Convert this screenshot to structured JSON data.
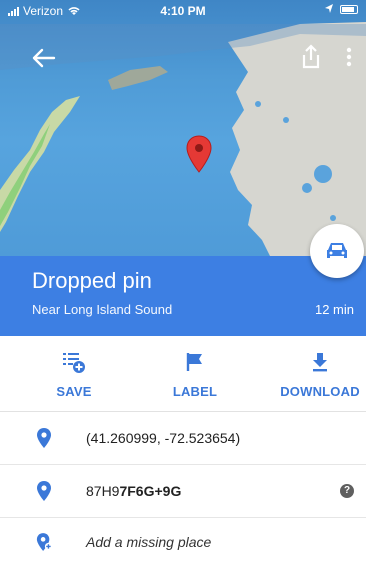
{
  "status_bar": {
    "carrier": "Verizon",
    "time": "4:10 PM"
  },
  "top_bar": {
    "back_icon": "back-arrow-icon",
    "share_icon": "share-icon",
    "more_icon": "more-vert-icon"
  },
  "place": {
    "title": "Dropped pin",
    "subtitle": "Near Long Island Sound",
    "eta": "12 min"
  },
  "actions": [
    {
      "label": "SAVE",
      "icon": "save-list-icon"
    },
    {
      "label": "LABEL",
      "icon": "flag-icon"
    },
    {
      "label": "DOWNLOAD",
      "icon": "download-icon"
    }
  ],
  "info": {
    "coordinates": "(41.260999, -72.523654)",
    "plus_code_prefix": "87H9",
    "plus_code_main": "7F6G+9G",
    "add_place": "Add a missing place"
  },
  "colors": {
    "accent": "#3d7fe3",
    "pin": "#e53935",
    "water": "#4f9bd6"
  }
}
